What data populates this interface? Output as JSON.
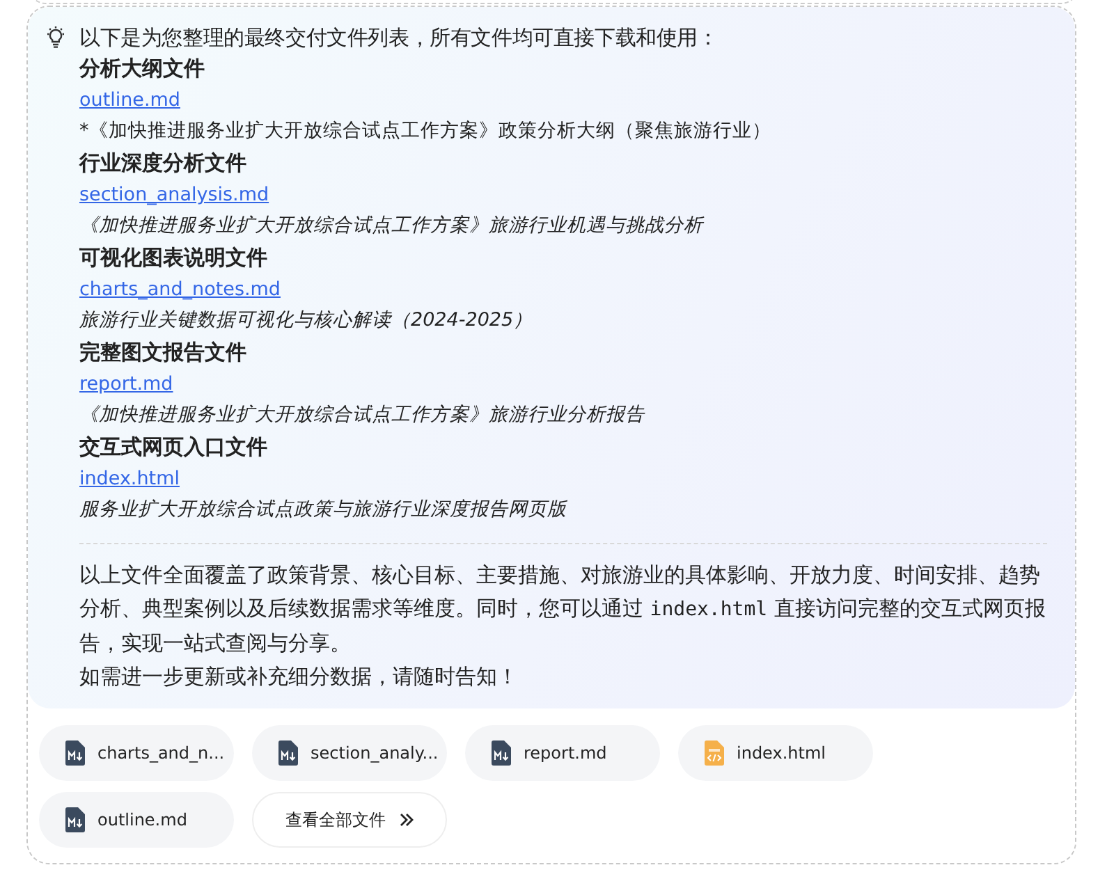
{
  "message": {
    "intro": "以下是为您整理的最终交付文件列表，所有文件均可直接下载和使用：",
    "files": [
      {
        "heading": "分析大纲文件",
        "link": "outline.md",
        "description": "*《加快推进服务业扩大开放综合试点工作方案》政策分析大纲（聚焦旅游行业）",
        "italic": false
      },
      {
        "heading": "行业深度分析文件",
        "link": "section_analysis.md",
        "description": "《加快推进服务业扩大开放综合试点工作方案》旅游行业机遇与挑战分析",
        "italic": true
      },
      {
        "heading": "可视化图表说明文件",
        "link": "charts_and_notes.md",
        "description": "旅游行业关键数据可视化与核心解读（2024-2025）",
        "italic": true
      },
      {
        "heading": "完整图文报告文件",
        "link": "report.md",
        "description": "《加快推进服务业扩大开放综合试点工作方案》旅游行业分析报告",
        "italic": true
      },
      {
        "heading": "交互式网页入口文件",
        "link": "index.html",
        "description": "服务业扩大开放综合试点政策与旅游行业深度报告网页版",
        "italic": true
      }
    ],
    "summary_before": "以上文件全面覆盖了政策背景、核心目标、主要措施、对旅游业的具体影响、开放力度、时间安排、趋势分析、典型案例以及后续数据需求等维度。同时，您可以通过 ",
    "summary_code": "index.html",
    "summary_after": " 直接访问完整的交互式网页报告，实现一站式查阅与分享。",
    "closing": "如需进一步更新或补充细分数据，请随时告知！"
  },
  "attachments": [
    {
      "name": "charts_and_n...",
      "kind": "markdown"
    },
    {
      "name": "section_analy...",
      "kind": "markdown"
    },
    {
      "name": "report.md",
      "kind": "markdown"
    },
    {
      "name": "index.html",
      "kind": "html"
    },
    {
      "name": "outline.md",
      "kind": "markdown"
    }
  ],
  "view_all": "查看全部文件"
}
